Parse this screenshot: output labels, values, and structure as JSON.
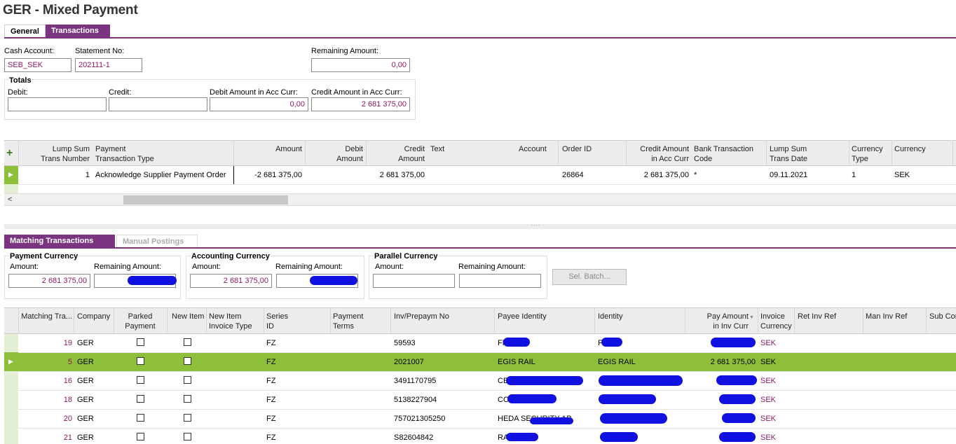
{
  "window": {
    "title": "GER - Mixed Payment"
  },
  "tabs": [
    {
      "label": "General"
    },
    {
      "label": "Transactions"
    }
  ],
  "header": {
    "cash_account_label": "Cash Account:",
    "cash_account_value": "SEB_SEK",
    "statement_no_label": "Statement No:",
    "statement_no_value": "202111-1",
    "remaining_amount_label": "Remaining Amount:",
    "remaining_amount_value": "0,00"
  },
  "totals": {
    "title": "Totals",
    "debit_label": "Debit:",
    "debit_value": "",
    "credit_label": "Credit:",
    "credit_value": "",
    "debit_acc_label": "Debit Amount in Acc Curr:",
    "debit_acc_value": "0,00",
    "credit_acc_label": "Credit Amount in Acc Curr:",
    "credit_acc_value": "2 681 375,00"
  },
  "top_grid": {
    "columns": [
      "Lump Sum Trans Number",
      "Payment Transaction Type",
      "Amount",
      "Debit Amount",
      "Credit Amount",
      "Text",
      "Account",
      "Order ID",
      "Credit Amount in Acc Curr",
      "Bank Transaction Code",
      "Lump Sum Trans Date",
      "Currency Type",
      "Currency"
    ],
    "header_lines": {
      "c1a": "Lump Sum",
      "c1b": "Trans Number",
      "c2a": "Payment",
      "c2b": "Transaction Type",
      "c3a": "Amount",
      "c4a": "Debit",
      "c4b": "Amount",
      "c5a": "Credit",
      "c5b": "Amount",
      "c6a": "Text",
      "c7a": "Account",
      "c8a": "Order ID",
      "c9a": "Credit Amount",
      "c9b": "in Acc Curr",
      "c10a": "Bank Transaction",
      "c10b": "Code",
      "c11a": "Lump Sum",
      "c11b": "Trans Date",
      "c12a": "Currency",
      "c12b": "Type",
      "c13a": "Currency"
    },
    "row": {
      "lump_sum": "1",
      "type": "Acknowledge Supplier Payment Order",
      "amount": "-2 681 375,00",
      "debit": "",
      "credit": "2 681 375,00",
      "text": "",
      "account": "",
      "order_id": "26864",
      "credit_acc": "2 681 375,00",
      "bank_code": "*",
      "date": "09.11.2021",
      "currency_type": "1",
      "currency": "SEK"
    },
    "add_icon": "+",
    "scroll_left_icon": "<"
  },
  "lower_tabs": [
    {
      "label": "Matching Transactions"
    },
    {
      "label": "Manual Postings"
    }
  ],
  "payment_currency": {
    "title": "Payment Currency",
    "amount_label": "Amount:",
    "amount_value": "2 681 375,00",
    "remaining_label": "Remaining Amount:"
  },
  "accounting_currency": {
    "title": "Accounting Currency",
    "amount_label": "Amount:",
    "amount_value": "2 681 375,00",
    "remaining_label": "Remaining Amount:"
  },
  "parallel_currency": {
    "title": "Parallel Currency",
    "amount_label": "Amount:",
    "amount_value": "",
    "remaining_label": "Remaining Amount:",
    "remaining_value": ""
  },
  "sel_batch_button": "Sel. Batch...",
  "match_grid": {
    "header_lines": {
      "h1": "Matching Tra...",
      "h2": "Company",
      "h3a": "Parked",
      "h3b": "Payment",
      "h4": "New Item",
      "h5a": "New Item",
      "h5b": "Invoice Type",
      "h6a": "Series",
      "h6b": "ID",
      "h7a": "Payment",
      "h7b": "Terms",
      "h8": "Inv/Prepaym No",
      "h9": "Payee Identity",
      "h10": "Identity",
      "h11a": "Pay Amount",
      "h11b": "in Inv Curr",
      "h12a": "Invoice",
      "h12b": "Currency",
      "h13": "Ret Inv Ref",
      "h14": "Man Inv Ref",
      "h15": "Sub Cor"
    },
    "rows": [
      {
        "num": "19",
        "company": "GER",
        "series": "FZ",
        "inv": "59593",
        "payee": "FR",
        "identity": "F",
        "pay": "",
        "cur": "SEK"
      },
      {
        "num": "5",
        "company": "GER",
        "series": "FZ",
        "inv": "2021007",
        "payee": "EGIS RAIL",
        "identity": "EGIS RAIL",
        "pay": "2 681 375,00",
        "cur": "SEK"
      },
      {
        "num": "16",
        "company": "GER",
        "series": "FZ",
        "inv": "3491170795",
        "payee": "CE",
        "identity": "",
        "pay": "",
        "cur": "SEK"
      },
      {
        "num": "18",
        "company": "GER",
        "series": "FZ",
        "inv": "5138227904",
        "payee": "CO",
        "identity": "",
        "pay": "",
        "cur": "SEK"
      },
      {
        "num": "20",
        "company": "GER",
        "series": "FZ",
        "inv": "757021305250",
        "payee": "HEDA SECURITY AB",
        "identity": "",
        "pay": "",
        "cur": "SEK"
      },
      {
        "num": "21",
        "company": "GER",
        "series": "FZ",
        "inv": "S82604842",
        "payee": "RA",
        "identity": "",
        "pay": "",
        "cur": "SEK"
      }
    ]
  },
  "colors": {
    "accent": "#7b3580",
    "value_text": "#8a1a64",
    "selected_row": "#8dbf3a",
    "redaction": "#1010e0"
  }
}
